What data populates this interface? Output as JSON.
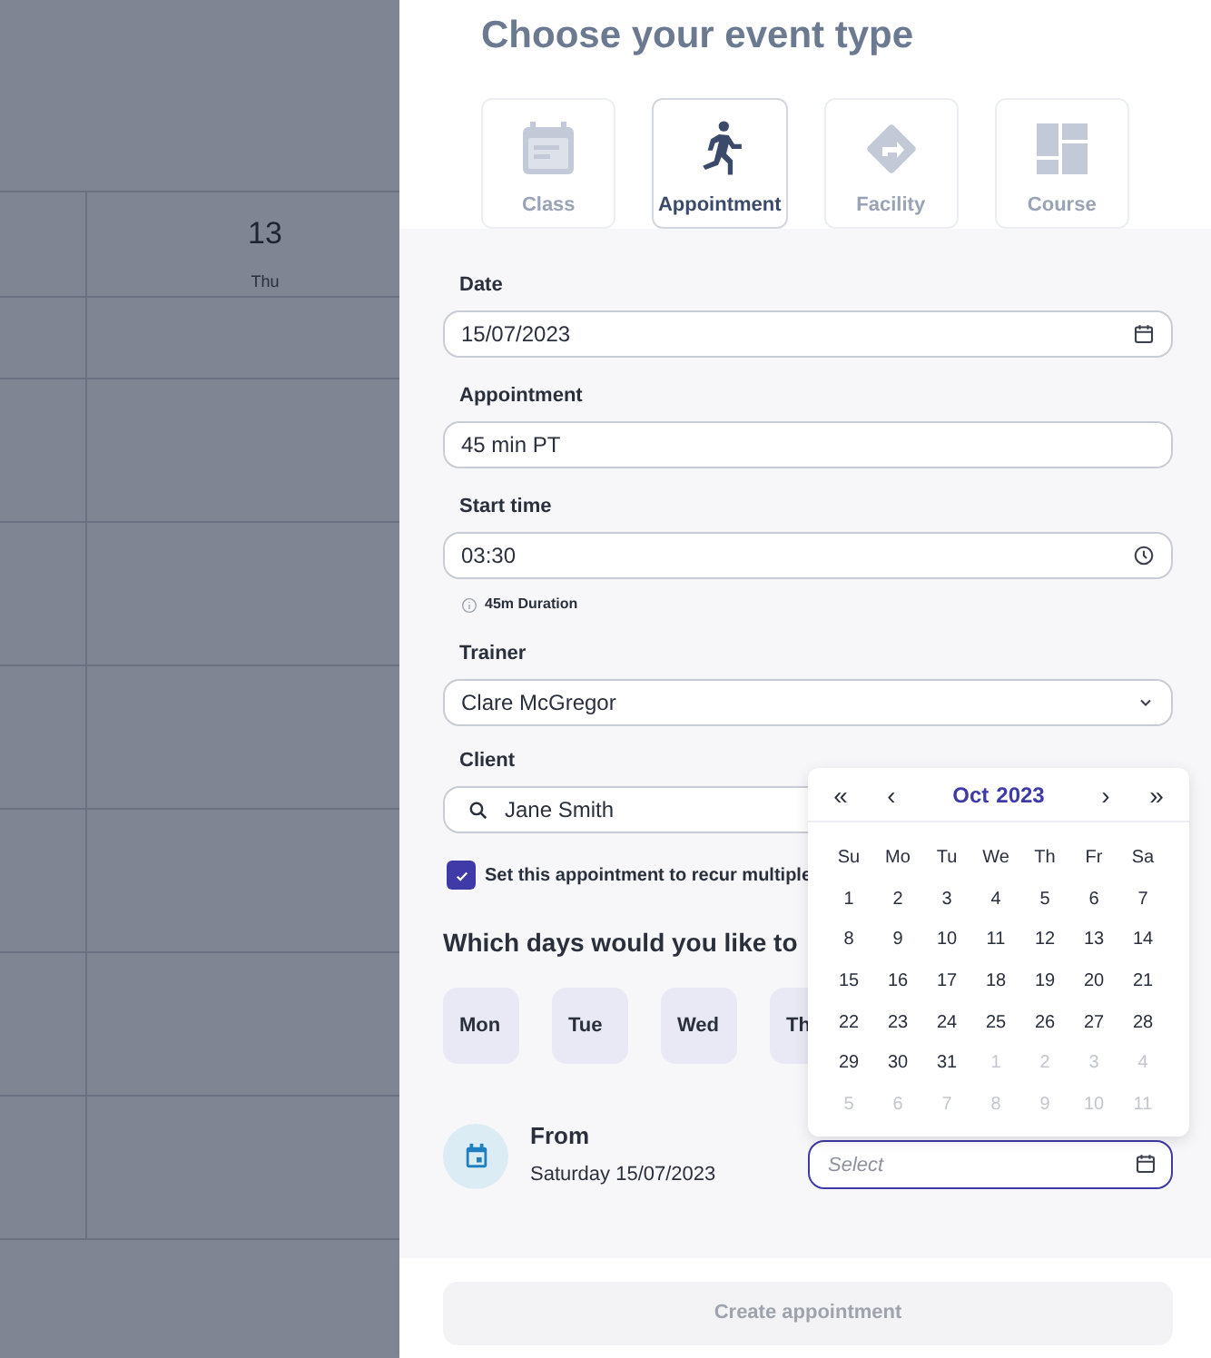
{
  "backdrop": {
    "day_number": "13",
    "day_name": "Thu"
  },
  "panel": {
    "title": "Choose your event type",
    "event_types": [
      {
        "label": "Class",
        "kind": "class",
        "selected": false
      },
      {
        "label": "Appointment",
        "kind": "appointment",
        "selected": true
      },
      {
        "label": "Facility",
        "kind": "facility",
        "selected": false
      },
      {
        "label": "Course",
        "kind": "course",
        "selected": false
      }
    ],
    "fields": [
      {
        "label": "Date",
        "value": "15/07/2023",
        "kind": "date"
      },
      {
        "label": "Appointment",
        "value": "45 min PT",
        "kind": "text"
      },
      {
        "label": "Start time",
        "value": "03:30",
        "kind": "time",
        "hint": "45m Duration"
      },
      {
        "label": "Trainer",
        "value": "Clare McGregor",
        "kind": "select"
      },
      {
        "label": "Client",
        "value": "Jane Smith",
        "kind": "search"
      }
    ],
    "recur": {
      "label": "Set this appointment to recur multiple",
      "checked": true
    },
    "days_heading": "Which days would you like to",
    "days": [
      {
        "label": "Mon",
        "selected": false
      },
      {
        "label": "Tue",
        "selected": false
      },
      {
        "label": "Wed",
        "selected": false
      },
      {
        "label": "Th",
        "selected": false
      }
    ],
    "from": {
      "label": "From",
      "value": "Saturday 15/07/2023"
    },
    "until": {
      "placeholder": "Select"
    },
    "datepicker": {
      "prev_year": "«",
      "prev_month": "‹",
      "month": "Oct",
      "year": "2023",
      "next_month": "›",
      "next_year": "»",
      "weekdays": [
        "Su",
        "Mo",
        "Tu",
        "We",
        "Th",
        "Fr",
        "Sa"
      ],
      "weeks": [
        [
          {
            "day": "1",
            "outside": false
          },
          {
            "day": "2",
            "outside": false
          },
          {
            "day": "3",
            "outside": false
          },
          {
            "day": "4",
            "outside": false
          },
          {
            "day": "5",
            "outside": false
          },
          {
            "day": "6",
            "outside": false
          },
          {
            "day": "7",
            "outside": false
          }
        ],
        [
          {
            "day": "8",
            "outside": false
          },
          {
            "day": "9",
            "outside": false
          },
          {
            "day": "10",
            "outside": false
          },
          {
            "day": "11",
            "outside": false
          },
          {
            "day": "12",
            "outside": false
          },
          {
            "day": "13",
            "outside": false
          },
          {
            "day": "14",
            "outside": false
          }
        ],
        [
          {
            "day": "15",
            "outside": false
          },
          {
            "day": "16",
            "outside": false
          },
          {
            "day": "17",
            "outside": false
          },
          {
            "day": "18",
            "outside": false
          },
          {
            "day": "19",
            "outside": false
          },
          {
            "day": "20",
            "outside": false
          },
          {
            "day": "21",
            "outside": false
          }
        ],
        [
          {
            "day": "22",
            "outside": false
          },
          {
            "day": "23",
            "outside": false
          },
          {
            "day": "24",
            "outside": false
          },
          {
            "day": "25",
            "outside": false
          },
          {
            "day": "26",
            "outside": false
          },
          {
            "day": "27",
            "outside": false
          },
          {
            "day": "28",
            "outside": false
          }
        ],
        [
          {
            "day": "29",
            "outside": false
          },
          {
            "day": "30",
            "outside": false
          },
          {
            "day": "31",
            "outside": false
          },
          {
            "day": "1",
            "outside": true
          },
          {
            "day": "2",
            "outside": true
          },
          {
            "day": "3",
            "outside": true
          },
          {
            "day": "4",
            "outside": true
          }
        ],
        [
          {
            "day": "5",
            "outside": true
          },
          {
            "day": "6",
            "outside": true
          },
          {
            "day": "7",
            "outside": true
          },
          {
            "day": "8",
            "outside": true
          },
          {
            "day": "9",
            "outside": true
          },
          {
            "day": "10",
            "outside": true
          },
          {
            "day": "11",
            "outside": true
          }
        ]
      ]
    },
    "submit": {
      "label": "Create appointment",
      "disabled": true
    }
  }
}
